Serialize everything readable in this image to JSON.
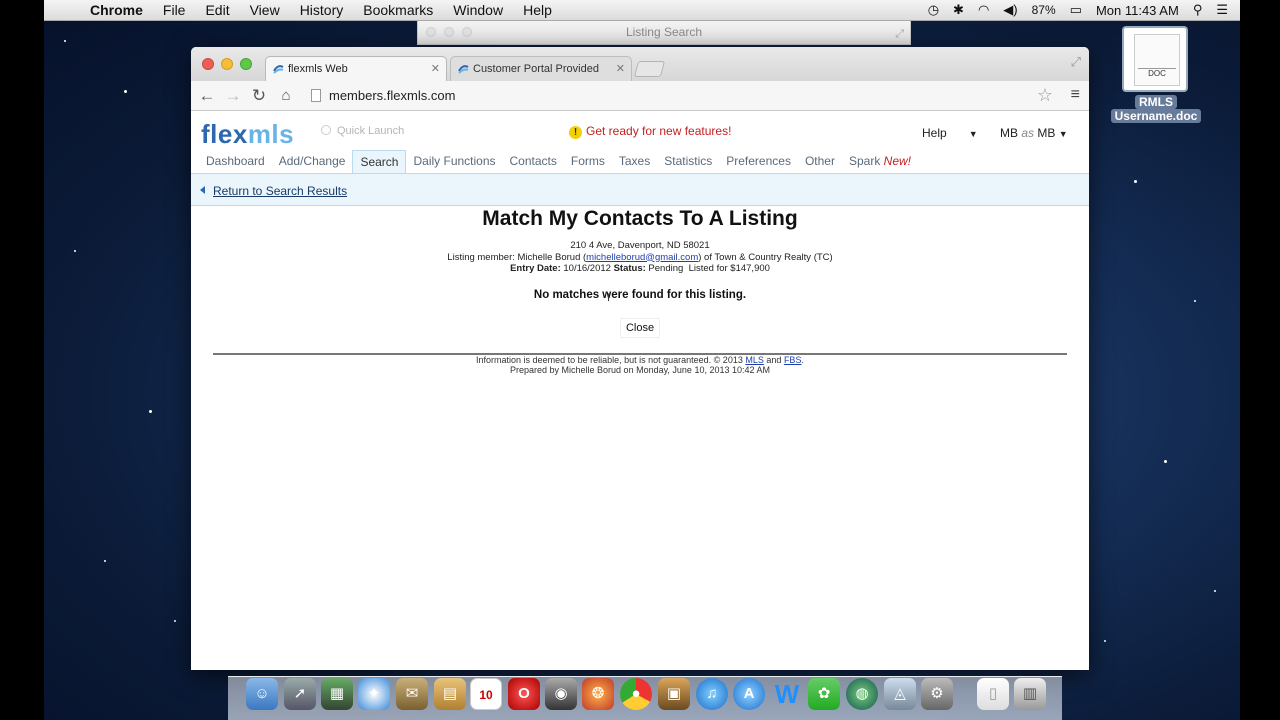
{
  "menubar": {
    "app": "Chrome",
    "items": [
      "File",
      "Edit",
      "View",
      "History",
      "Bookmarks",
      "Window",
      "Help"
    ],
    "battery": "87%",
    "clock": "Mon 11:43 AM"
  },
  "background_window": {
    "title": "Listing Search"
  },
  "desktop_file": {
    "label_line1": "RMLS",
    "label_line2": "Username.doc",
    "icon_text": "DOC"
  },
  "browser": {
    "tabs": [
      {
        "title": "flexmls Web",
        "active": true
      },
      {
        "title": "Customer Portal Provided",
        "active": false
      }
    ],
    "url": "members.flexmls.com"
  },
  "app": {
    "logo_a": "flex",
    "logo_b": "mls",
    "quick_launch_placeholder": "Quick Launch",
    "notice": "Get ready for new features!",
    "help_label": "Help",
    "user_from": "MB",
    "user_as": "as",
    "user_to": "MB",
    "nav": [
      {
        "label": "Dashboard"
      },
      {
        "label": "Add/Change"
      },
      {
        "label": "Search"
      },
      {
        "label": "Daily Functions"
      },
      {
        "label": "Contacts"
      },
      {
        "label": "Forms"
      },
      {
        "label": "Taxes"
      },
      {
        "label": "Statistics"
      },
      {
        "label": "Preferences"
      },
      {
        "label": "Other"
      },
      {
        "label": "Spark",
        "badge": "New!"
      }
    ],
    "return_link": "Return to Search Results"
  },
  "content": {
    "title": "Match My Contacts To A Listing",
    "address": "210 4 Ave, Davenport, ND 58021",
    "listing_member_prefix": "Listing member: Michelle Borud (",
    "listing_member_email": "michelleborud@gmail.com",
    "listing_member_suffix": ") of Town & Country Realty (TC)",
    "entry_date_label": "Entry Date:",
    "entry_date": "10/16/2012",
    "status_label": "Status:",
    "status": "Pending",
    "listed_for": "Listed for $147,900",
    "no_match": "No matches were found for this listing.",
    "close_label": "Close",
    "footer_line1_prefix": "Information is deemed to be reliable, but is not guaranteed. © 2013",
    "footer_link_mls": "MLS",
    "footer_and": "and",
    "footer_link_fbs": "FBS",
    "footer_period": ".",
    "footer_line2": "Prepared by Michelle Borud on Monday, June 10, 2013 10:42 AM"
  },
  "dock": {
    "calendar_day": "10"
  }
}
